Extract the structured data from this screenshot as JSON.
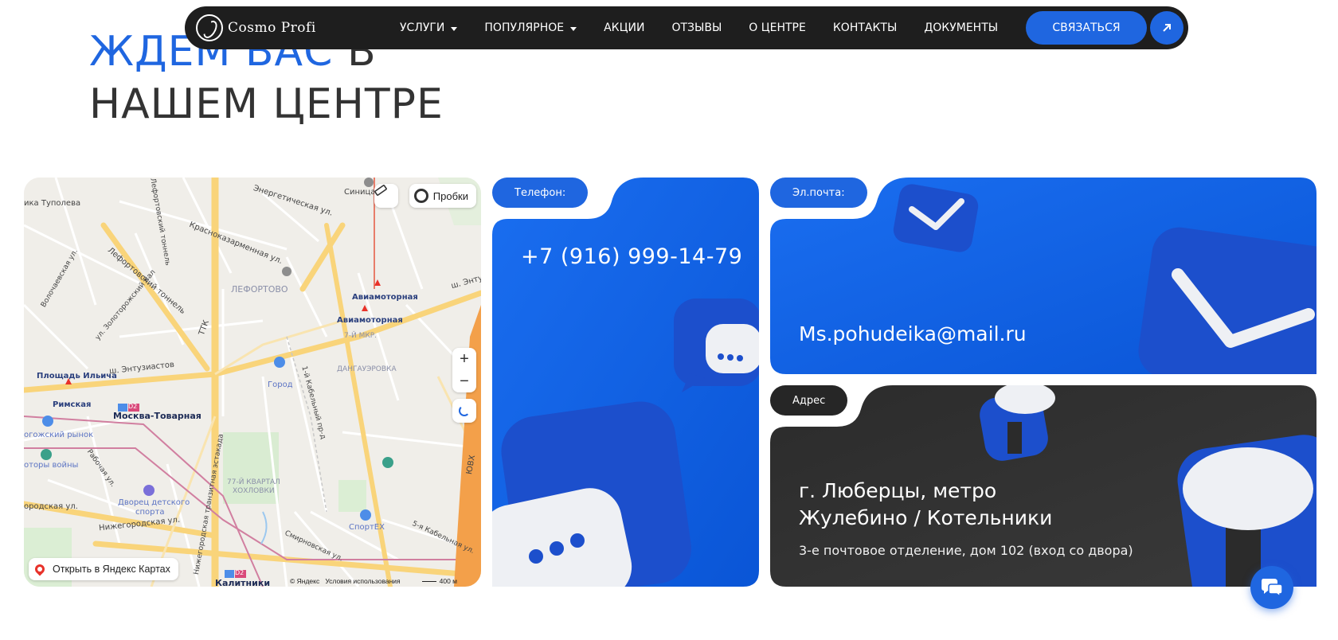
{
  "nav": {
    "logo_text": "Cosmo Profi",
    "items": [
      {
        "label": "УСЛУГИ",
        "has_dropdown": true
      },
      {
        "label": "ПОПУЛЯРНОЕ",
        "has_dropdown": true
      },
      {
        "label": "АКЦИИ",
        "has_dropdown": false
      },
      {
        "label": "ОТЗЫВЫ",
        "has_dropdown": false
      },
      {
        "label": "О ЦЕНТРЕ",
        "has_dropdown": false
      },
      {
        "label": "КОНТАКТЫ",
        "has_dropdown": false
      },
      {
        "label": "ДОКУМЕНТЫ",
        "has_dropdown": false
      }
    ],
    "contact_label": "СВЯЗАТЬСЯ",
    "arrow_icon": "arrow-up-right-icon"
  },
  "heading": {
    "accent": "ЖДЕМ ВАС",
    "line1_rest": " В",
    "line2": "НАШЕМ ЦЕНТРЕ"
  },
  "map": {
    "traffic_label": "Пробки",
    "open_label": "Открыть в Яндекс Картах",
    "copyright": "© Яндекс",
    "terms": "Условия использования",
    "scale": "400 м",
    "labels": {
      "tupoleva": "ика Туполева",
      "lefortovo": "ЛЕФОРТОВО",
      "aviamotornaya1": "Авиамоторная",
      "aviamotornaya2": "Авиамоторная",
      "ilyicha": "Площадь Ильича",
      "rimskaya": "Римская",
      "moskva_tovarnaya": "Москва-Товарная",
      "entuziastov": "ш. Энтузиастов",
      "entuziastov2": "ш. Энту",
      "gorod": "Город",
      "dangauerovka": "ДАНГАУЭРОВКА",
      "mkr7": "7-Й МКР.",
      "rogozhsky": "огожский рынок",
      "motory": "оторы войны",
      "dvorets": "Дворец детского",
      "sporta": "спорта",
      "kvartal1": "77-Й КВАРТАЛ",
      "kvartal2": "ХОХЛОВКИ",
      "sportex": "СпортЕХ",
      "nizhegorodskaya": "Нижегородская ул.",
      "nizhegorodskaya2": "ородская ул.",
      "kalitniki": "Калитники",
      "sinitsa": "Синица",
      "lefortovo_tunnel": "Лефортовский тоннель",
      "krasnokaz": "Красноказарменная ул.",
      "energeticheskaya": "Энергетическая ул.",
      "ttk": "ТТК",
      "yuvkh": "ЮВХ",
      "estakada": "Нижегородская транзитная эстакада",
      "smirnovskaya": "Смирновская ул.",
      "kabelnaya5": "5-я Кабельная ул.",
      "kabelnaya1": "1-й Кабельный пр-д",
      "rabochaya": "Рабочая ул.",
      "zolotorozhsky": "ул. Золоторожский Вал",
      "volochaevskaya": "Волочаевская ул.",
      "tunnel2": "Лефортовский тоннель",
      "d2a": "D2",
      "d2b": "D2"
    }
  },
  "cards": {
    "phone": {
      "label": "Телефон:",
      "value": "+7 (916) 999-14-79"
    },
    "email": {
      "label": "Эл.почта:",
      "value": "Ms.pohudeika@mail.ru"
    },
    "address": {
      "label": "Адрес",
      "line1": "г. Люберцы, метро",
      "line2": "Жулебино / Котельники",
      "detail": "3-е почтовое отделение, дом 102 (вход со двора)"
    }
  },
  "colors": {
    "accent": "#1f66e0",
    "nav_bg": "#1e1e1e",
    "dark_card": "#2a2a2a"
  },
  "chat_icon": "chat-bubbles-icon"
}
